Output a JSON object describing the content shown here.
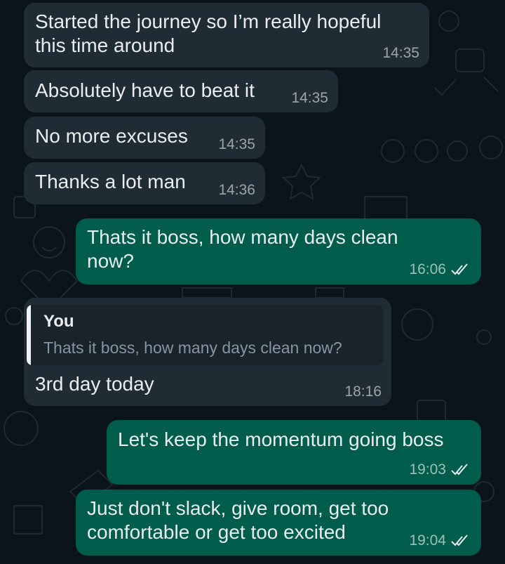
{
  "wallpaper": {
    "background_color": "#0b141a",
    "doodle_icons": [
      "smiley-icon",
      "star-icon",
      "heart-icon",
      "rupee-icon",
      "calendar-icon",
      "dollar-icon"
    ]
  },
  "colors": {
    "incoming_bubble": "#202c33",
    "outgoing_bubble": "#005c4b",
    "read_tick": "#e9edef"
  },
  "messages": [
    {
      "direction": "in",
      "text": "Started the journey so I’m really hopeful\nthis time around",
      "time": "14:35"
    },
    {
      "direction": "in",
      "text": "Absolutely have to beat it",
      "time": "14:35"
    },
    {
      "direction": "in",
      "text": "No more excuses",
      "time": "14:35"
    },
    {
      "direction": "in",
      "text": "Thanks a lot man",
      "time": "14:36"
    },
    {
      "direction": "out",
      "text": "Thats it boss, how many days clean\nnow?",
      "time": "16:06",
      "status": "read"
    },
    {
      "direction": "in",
      "quote": {
        "author": "You",
        "text": "Thats it boss, how many days clean now?"
      },
      "text": "3rd day today",
      "time": "18:16"
    },
    {
      "direction": "out",
      "text": "Let's keep the momentum going boss",
      "time": "19:03",
      "status": "read"
    },
    {
      "direction": "out",
      "text": "Just don't slack, give room, get too\ncomfortable or get too excited",
      "time": "19:04",
      "status": "read"
    }
  ]
}
